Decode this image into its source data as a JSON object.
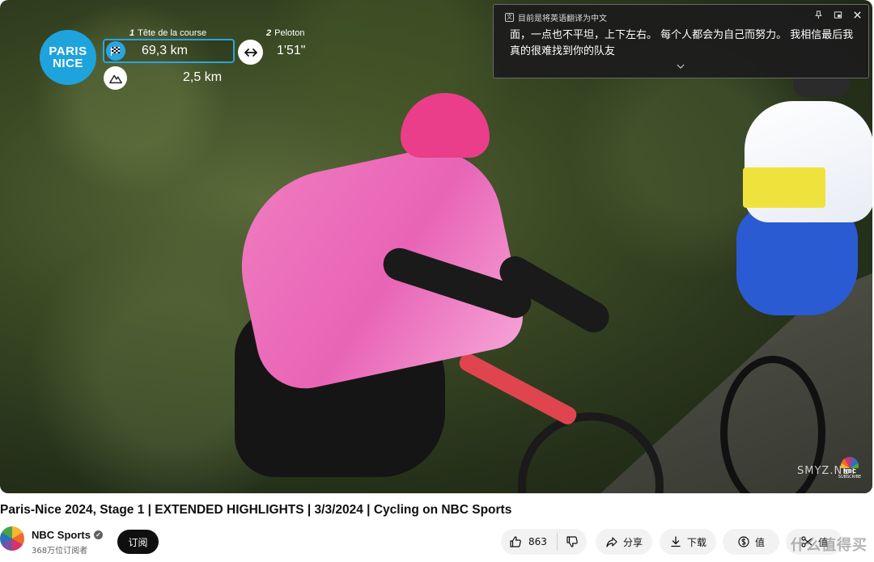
{
  "overlay": {
    "race_logo_line1": "PARIS",
    "race_logo_line2": "NICE",
    "group1_number": "1",
    "group1_label": "Tête de la course",
    "group2_number": "2",
    "group2_label": "Peloton",
    "distance_to_finish": "69,3 km",
    "gap_time": "1'51\"",
    "climb_distance": "2,5 km",
    "broadcaster_watermark_line1": "NBC",
    "broadcaster_watermark_line2": "SUBSCRIBE",
    "site_watermark_small": "SMYZ.NET"
  },
  "translation_panel": {
    "header": "目前是将英语翻译为中文",
    "text": "面，一点也不平坦，上下左右。 每个人都会为自己而努力。 我相信最后我真的很难找到你的队友",
    "actions": [
      "pin-icon",
      "window-icon",
      "close-icon"
    ]
  },
  "video": {
    "title": "Paris-Nice 2024, Stage 1 | EXTENDED HIGHLIGHTS | 3/3/2024 | Cycling on NBC Sports"
  },
  "channel": {
    "name": "NBC Sports",
    "subscribers": "368万位订阅者",
    "subscribe_label": "订阅"
  },
  "actions": {
    "like_count": "863",
    "share_label": "分享",
    "download_label": "下载",
    "thanks_label": "值",
    "clip_label": "值"
  },
  "page_watermark": "什么值得买"
}
